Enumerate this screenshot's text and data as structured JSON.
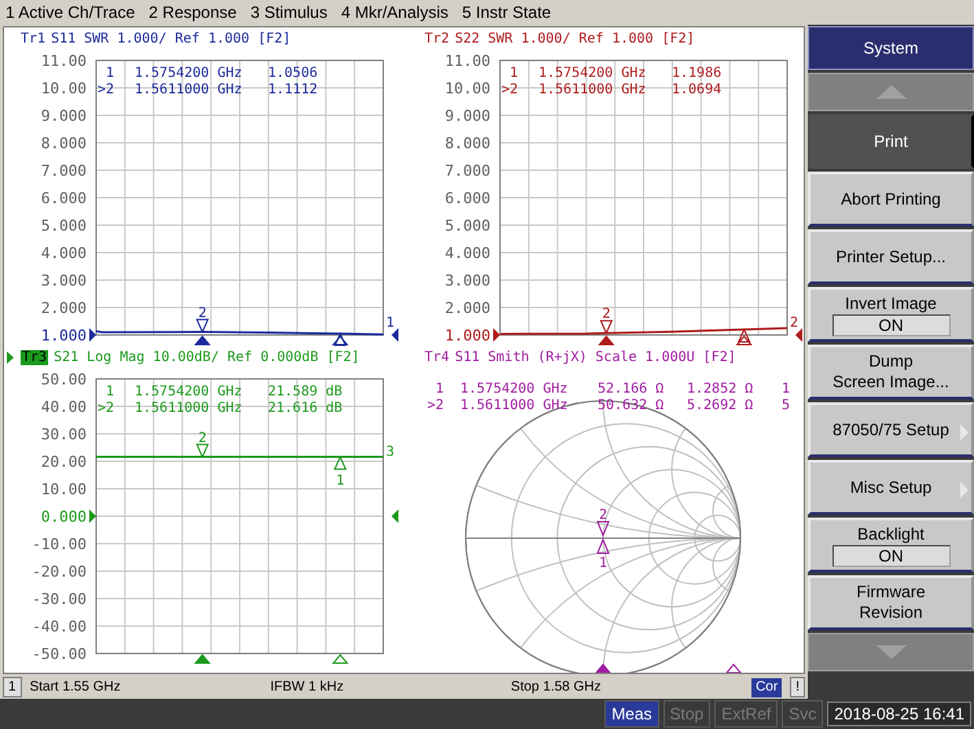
{
  "menu": [
    {
      "label": "1 Active Ch/Trace"
    },
    {
      "label": "2 Response"
    },
    {
      "label": "3 Stimulus"
    },
    {
      "label": "4 Mkr/Analysis"
    },
    {
      "label": "5 Instr State"
    }
  ],
  "traces": [
    {
      "kind": "swr",
      "trace": "Tr1",
      "title": "S11 SWR 1.000/ Ref 1.000 [F2]",
      "selected": false,
      "color": "#1c2a9c",
      "readout": [
        {
          "marker": "1",
          "values": [
            "1.5754200 GHz",
            "1.0506"
          ]
        },
        {
          "marker": ">2",
          "values": [
            "1.5611000 GHz",
            "1.1112"
          ]
        }
      ],
      "y_labels": [
        {
          "label": "11.00",
          "reference": false
        },
        {
          "label": "10.00",
          "reference": false
        },
        {
          "label": "9.000",
          "reference": false
        },
        {
          "label": "8.000",
          "reference": false
        },
        {
          "label": "7.000",
          "reference": false
        },
        {
          "label": "6.000",
          "reference": false
        },
        {
          "label": "5.000",
          "reference": false
        },
        {
          "label": "4.000",
          "reference": false
        },
        {
          "label": "3.000",
          "reference": false
        },
        {
          "label": "2.000",
          "reference": false
        },
        {
          "label": "1.000",
          "reference": true
        }
      ],
      "markers": [
        {
          "label": "2",
          "selected": true
        },
        {
          "selected": false
        }
      ],
      "end_label": "1"
    },
    {
      "kind": "swr",
      "trace": "Tr2",
      "title": "S22 SWR 1.000/ Ref 1.000 [F2]",
      "selected": false,
      "color": "#b01c1c",
      "readout": [
        {
          "marker": "1",
          "values": [
            "1.5754200 GHz",
            "1.1986"
          ]
        },
        {
          "marker": ">2",
          "values": [
            "1.5611000 GHz",
            "1.0694"
          ]
        }
      ],
      "y_labels": [
        {
          "label": "11.00",
          "reference": false
        },
        {
          "label": "10.00",
          "reference": false
        },
        {
          "label": "9.000",
          "reference": false
        },
        {
          "label": "8.000",
          "reference": false
        },
        {
          "label": "7.000",
          "reference": false
        },
        {
          "label": "6.000",
          "reference": false
        },
        {
          "label": "5.000",
          "reference": false
        },
        {
          "label": "4.000",
          "reference": false
        },
        {
          "label": "3.000",
          "reference": false
        },
        {
          "label": "2.000",
          "reference": false
        },
        {
          "label": "1.000",
          "reference": true
        }
      ],
      "markers": [
        {
          "label": "2",
          "selected": true
        },
        {
          "selected": false
        }
      ],
      "end_label": "2"
    },
    {
      "kind": "logmag",
      "trace": "Tr3",
      "title": "S21 Log Mag 10.00dB/ Ref 0.000dB [F2]",
      "selected": true,
      "color": "#1c9a1c",
      "readout": [
        {
          "marker": "1",
          "values": [
            "1.5754200 GHz",
            "21.589 dB"
          ]
        },
        {
          "marker": ">2",
          "values": [
            "1.5611000 GHz",
            "21.616 dB"
          ]
        }
      ],
      "y_labels": [
        {
          "label": "50.00",
          "reference": false
        },
        {
          "label": "40.00",
          "reference": false
        },
        {
          "label": "30.00",
          "reference": false
        },
        {
          "label": "20.00",
          "reference": false
        },
        {
          "label": "10.00",
          "reference": false
        },
        {
          "label": "0.000",
          "reference": true
        },
        {
          "label": "-10.00",
          "reference": false
        },
        {
          "label": "-20.00",
          "reference": false
        },
        {
          "label": "-30.00",
          "reference": false
        },
        {
          "label": "-40.00",
          "reference": false
        },
        {
          "label": "-50.00",
          "reference": false
        }
      ],
      "markers": [
        {
          "label": "2",
          "selected": true
        },
        {
          "label": "1",
          "selected": false
        }
      ],
      "end_label": "3"
    },
    {
      "kind": "smith",
      "trace": "Tr4",
      "title": "S11 Smith (R+jX) Scale 1.000U [F2]",
      "selected": false,
      "color": "#a01ca0",
      "readout": [
        {
          "marker": "1",
          "values": [
            "1.5754200 GHz",
            "52.166 Ω",
            "1.2852 Ω",
            "1"
          ]
        },
        {
          "marker": ">2",
          "values": [
            "1.5611000 GHz",
            "50.632 Ω",
            "5.2692 Ω",
            "5"
          ]
        }
      ],
      "markers": [
        {
          "label": "2",
          "selected": true
        },
        {
          "label": "1",
          "selected": false
        }
      ]
    }
  ],
  "status": [
    {
      "text": "1",
      "kind": "box"
    },
    {
      "text": "Start 1.55 GHz",
      "kind": "text"
    },
    {
      "text": "IFBW 1 kHz",
      "kind": "text"
    },
    {
      "text": "Stop 1.58 GHz",
      "kind": "text"
    },
    {
      "text": "Cor",
      "kind": "badge"
    },
    {
      "text": "!",
      "kind": "box"
    }
  ],
  "softkeys": {
    "title": "System",
    "items": [
      {
        "label": "Print",
        "kind": "action",
        "selected": true
      },
      {
        "label": "Abort Printing",
        "kind": "action",
        "selected": false
      },
      {
        "label": "Printer Setup...",
        "kind": "action",
        "selected": false
      },
      {
        "label": "Invert Image",
        "kind": "toggle",
        "value": "ON",
        "selected": false
      },
      {
        "label": "Dump\nScreen Image...",
        "kind": "action",
        "selected": false
      },
      {
        "label": "87050/75 Setup",
        "kind": "submenu",
        "selected": false
      },
      {
        "label": "Misc Setup",
        "kind": "submenu",
        "selected": false
      },
      {
        "label": "Backlight",
        "kind": "toggle",
        "value": "ON",
        "selected": false
      },
      {
        "label": "Firmware\nRevision",
        "kind": "action",
        "selected": false
      }
    ]
  },
  "indicators": [
    {
      "label": "Meas",
      "on": true
    },
    {
      "label": "Stop",
      "on": false
    },
    {
      "label": "ExtRef",
      "on": false
    },
    {
      "label": "Svc",
      "on": false
    }
  ],
  "clock": "2018-08-25 16:41"
}
